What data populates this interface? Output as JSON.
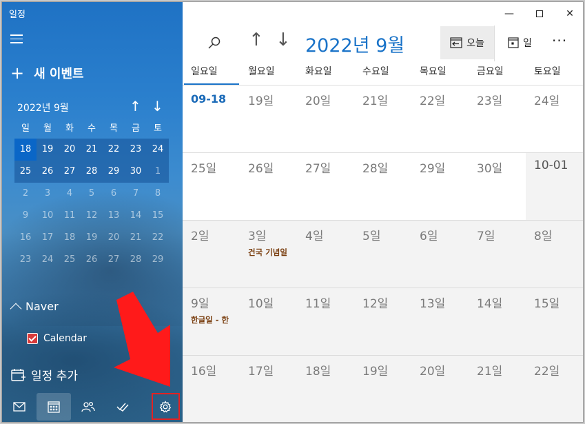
{
  "app": {
    "title": "일정"
  },
  "sidebar": {
    "new_event": "새 이벤트",
    "mini_calendar": {
      "title": "2022년 9월",
      "weekday_headers": [
        "일",
        "월",
        "화",
        "수",
        "목",
        "금",
        "토"
      ],
      "weeks": [
        [
          "18",
          "19",
          "20",
          "21",
          "22",
          "23",
          "24"
        ],
        [
          "25",
          "26",
          "27",
          "28",
          "29",
          "30",
          "1"
        ],
        [
          "2",
          "3",
          "4",
          "5",
          "6",
          "7",
          "8"
        ],
        [
          "9",
          "10",
          "11",
          "12",
          "13",
          "14",
          "15"
        ],
        [
          "16",
          "17",
          "18",
          "19",
          "20",
          "21",
          "22"
        ],
        [
          "23",
          "24",
          "25",
          "26",
          "27",
          "28",
          "29"
        ]
      ],
      "selected": "18"
    },
    "account": {
      "name": "Naver",
      "calendars": [
        {
          "label": "Calendar",
          "checked": true,
          "color": "#d93a3a"
        }
      ]
    },
    "add_calendar": "일정 추가",
    "bottom_nav": [
      "mail-icon",
      "calendar-icon",
      "people-icon",
      "todo-icon",
      "settings-icon"
    ]
  },
  "toolbar": {
    "month_title": "2022년 9월",
    "today_label": "오늘",
    "view_label": "일",
    "more_label": "···"
  },
  "month_view": {
    "weekdays": [
      "일요일",
      "월요일",
      "화요일",
      "수요일",
      "목요일",
      "금요일",
      "토요일"
    ],
    "weeks": [
      [
        {
          "d": "09-18",
          "today": true
        },
        {
          "d": "19일"
        },
        {
          "d": "20일"
        },
        {
          "d": "21일"
        },
        {
          "d": "22일"
        },
        {
          "d": "23일"
        },
        {
          "d": "24일"
        }
      ],
      [
        {
          "d": "25일"
        },
        {
          "d": "26일"
        },
        {
          "d": "27일"
        },
        {
          "d": "28일"
        },
        {
          "d": "29일"
        },
        {
          "d": "30일"
        },
        {
          "d": "10-01"
        }
      ],
      [
        {
          "d": "2일"
        },
        {
          "d": "3일",
          "event": "건국 기념일"
        },
        {
          "d": "4일"
        },
        {
          "d": "5일"
        },
        {
          "d": "6일"
        },
        {
          "d": "7일"
        },
        {
          "d": "8일"
        }
      ],
      [
        {
          "d": "9일",
          "event": "한글일 - 한"
        },
        {
          "d": "10일"
        },
        {
          "d": "11일"
        },
        {
          "d": "12일"
        },
        {
          "d": "13일"
        },
        {
          "d": "14일"
        },
        {
          "d": "15일"
        }
      ],
      [
        {
          "d": "16일"
        },
        {
          "d": "17일"
        },
        {
          "d": "18일"
        },
        {
          "d": "19일"
        },
        {
          "d": "20일"
        },
        {
          "d": "21일"
        },
        {
          "d": "22일"
        }
      ]
    ]
  },
  "colors": {
    "accent": "#1a73c8",
    "annotation": "#e32222"
  }
}
